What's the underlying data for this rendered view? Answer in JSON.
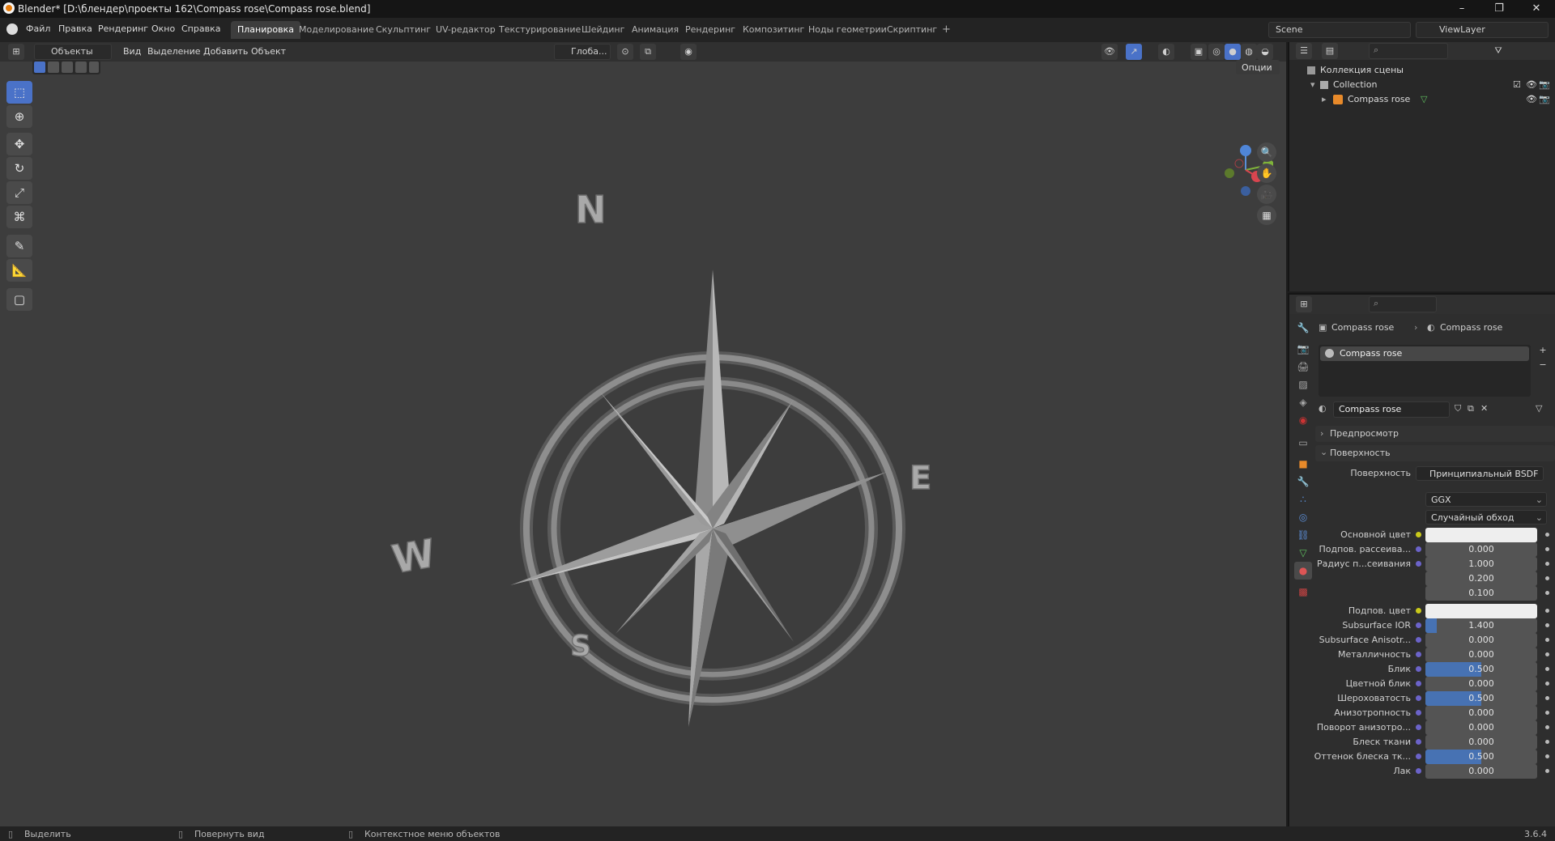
{
  "window": {
    "title": "Blender* [D:\\блендер\\проекты 162\\Compass rose\\Compass rose.blend]"
  },
  "menu": {
    "items": [
      "Файл",
      "Правка",
      "Рендеринг",
      "Окно",
      "Справка"
    ]
  },
  "workspaces": [
    "Планировка",
    "Моделирование",
    "Скульптинг",
    "UV-редактор",
    "Текстурирование",
    "Шейдинг",
    "Анимация",
    "Рендеринг",
    "Композитинг",
    "Ноды геометрии",
    "Скриптинг"
  ],
  "scene": {
    "name": "Scene",
    "view_layer": "ViewLayer"
  },
  "viewport_header": {
    "mode": "Объекты",
    "menus": [
      "Вид",
      "Выделение",
      "Добавить",
      "Объект"
    ],
    "orientation": "Глоба...",
    "options": "Опции"
  },
  "compass": {
    "north": "N",
    "east": "E",
    "south": "S",
    "west": "W"
  },
  "outliner": {
    "scene_collection": "Коллекция сцены",
    "collection": "Collection",
    "object": "Compass rose"
  },
  "properties": {
    "breadcrumb_object": "Compass rose",
    "breadcrumb_material": "Compass rose",
    "slot": "Compass rose",
    "material_name": "Compass rose",
    "panel_preview": "Предпросмотр",
    "panel_surface": "Поверхность",
    "surface_label": "Поверхность",
    "surface_value": "Принципиальный BSDF",
    "distribution": "GGX",
    "subsurface_method": "Случайный обход",
    "rows": [
      {
        "label": "Основной цвет",
        "value": "",
        "kind": "color",
        "dot": "yellow"
      },
      {
        "label": "Подпов. рассеива...",
        "value": "0.000",
        "kind": "num",
        "dot": "blue",
        "fill": 0
      },
      {
        "label": "Радиус п...сеивания",
        "value": "1.000",
        "kind": "num",
        "dot": "blue",
        "fill": 0
      },
      {
        "label": "",
        "value": "0.200",
        "kind": "num",
        "dot": "none",
        "fill": 0
      },
      {
        "label": "",
        "value": "0.100",
        "kind": "num",
        "dot": "none",
        "fill": 0
      },
      {
        "label": "Подпов. цвет",
        "value": "",
        "kind": "color",
        "dot": "yellow"
      },
      {
        "label": "Subsurface IOR",
        "value": "1.400",
        "kind": "num",
        "dot": "blue",
        "fill": 0.1
      },
      {
        "label": "Subsurface Anisotr...",
        "value": "0.000",
        "kind": "num",
        "dot": "blue",
        "fill": 0
      },
      {
        "label": "Металличность",
        "value": "0.000",
        "kind": "num",
        "dot": "blue",
        "fill": 0
      },
      {
        "label": "Блик",
        "value": "0.500",
        "kind": "num",
        "dot": "blue",
        "fill": 0.5
      },
      {
        "label": "Цветной блик",
        "value": "0.000",
        "kind": "num",
        "dot": "blue",
        "fill": 0
      },
      {
        "label": "Шероховатость",
        "value": "0.500",
        "kind": "num",
        "dot": "blue",
        "fill": 0.5
      },
      {
        "label": "Анизотропность",
        "value": "0.000",
        "kind": "num",
        "dot": "blue",
        "fill": 0
      },
      {
        "label": "Поворот анизотро...",
        "value": "0.000",
        "kind": "num",
        "dot": "blue",
        "fill": 0
      },
      {
        "label": "Блеск ткани",
        "value": "0.000",
        "kind": "num",
        "dot": "blue",
        "fill": 0
      },
      {
        "label": "Оттенок блеска тк...",
        "value": "0.500",
        "kind": "num",
        "dot": "blue",
        "fill": 0.5
      },
      {
        "label": "Лак",
        "value": "0.000",
        "kind": "num",
        "dot": "blue",
        "fill": 0
      }
    ]
  },
  "status": {
    "left": "Выделить",
    "middle": "Повернуть вид",
    "right": "Контекстное меню объектов",
    "version": "3.6.4"
  }
}
